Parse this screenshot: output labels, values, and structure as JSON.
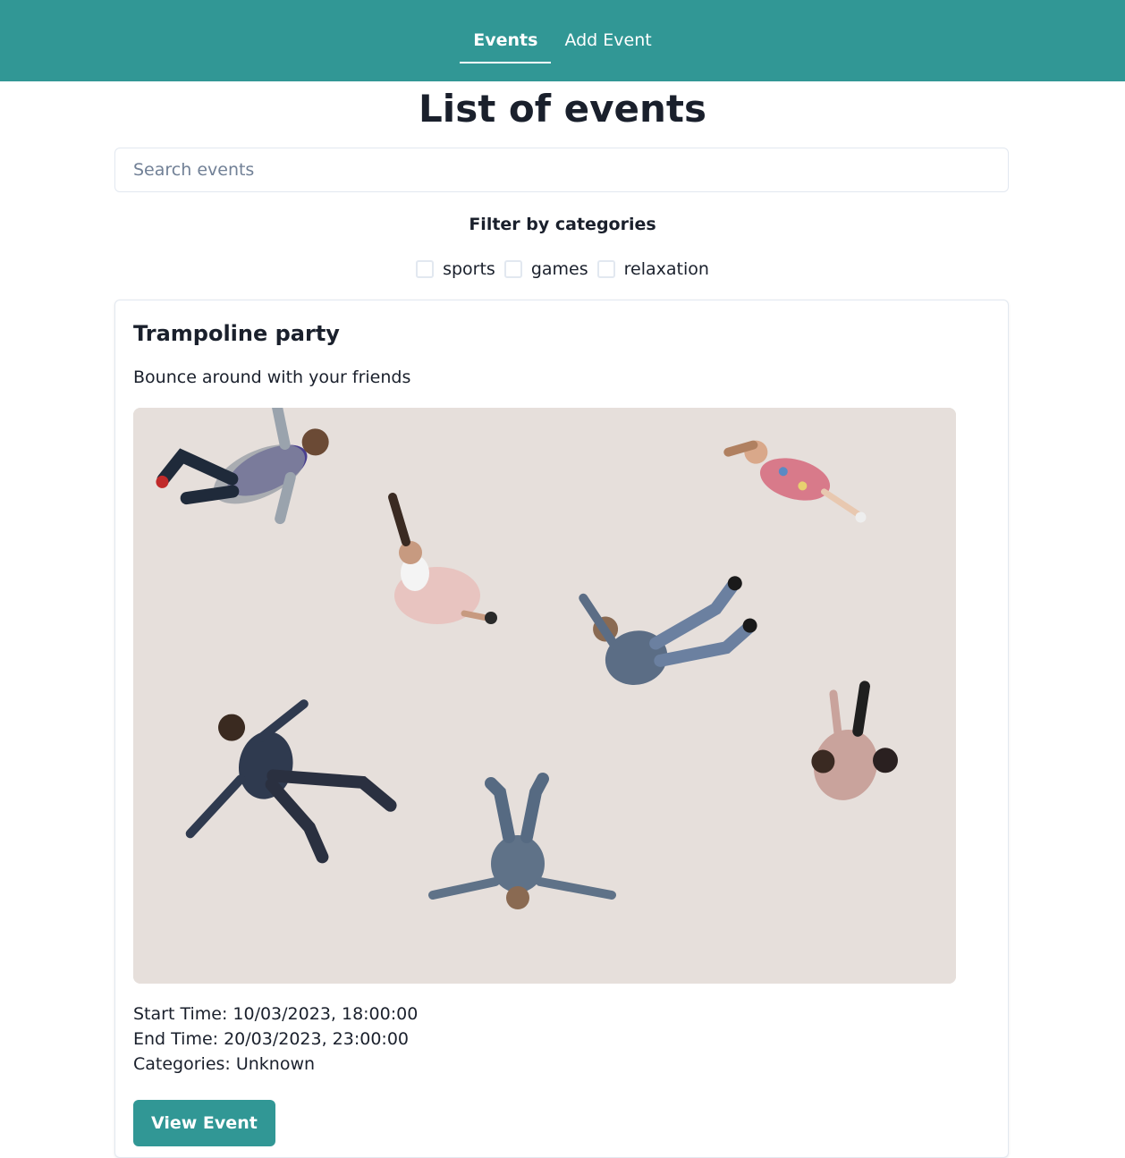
{
  "nav": {
    "items": [
      {
        "label": "Events",
        "active": true
      },
      {
        "label": "Add Event",
        "active": false
      }
    ],
    "color": "#319795"
  },
  "page": {
    "title": "List of events"
  },
  "search": {
    "placeholder": "Search events",
    "value": ""
  },
  "filters": {
    "title": "Filter by categories",
    "options": [
      {
        "label": "sports",
        "checked": false
      },
      {
        "label": "games",
        "checked": false
      },
      {
        "label": "relaxation",
        "checked": false
      }
    ]
  },
  "events": [
    {
      "title": "Trampoline party",
      "description": "Bounce around with your friends",
      "image_subject": "people-jumping-mid-air",
      "start_time": "Start Time: 10/03/2023, 18:00:00",
      "end_time": "End Time: 20/03/2023, 23:00:00",
      "categories": "Categories: Unknown",
      "button_label": "View Event"
    }
  ]
}
